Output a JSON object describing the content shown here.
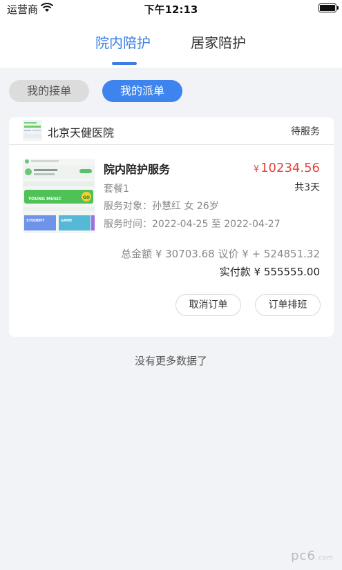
{
  "status_bar": {
    "carrier": "运营商",
    "time": "下午12:13"
  },
  "top_tabs": [
    {
      "label": "院内陪护",
      "active": true
    },
    {
      "label": "居家陪护",
      "active": false
    }
  ],
  "sub_tabs": [
    {
      "label": "我的接单",
      "active": false
    },
    {
      "label": "我的派单",
      "active": true
    }
  ],
  "order": {
    "hospital": "北京天健医院",
    "status": "待服务",
    "service_name": "院内陪护服务",
    "price_symbol": "¥",
    "price": "10234.56",
    "package": "套餐1",
    "days": "共3天",
    "service_object": "服务对象：孙慧红 女 26岁",
    "service_time": "服务时间：2022-04-25 至 2022-04-27",
    "totals": "总金额 ¥ 30703.68  议价 ¥ + 524851.32",
    "paid": "实付款 ¥ 555555.00",
    "cancel_button": "取消订单",
    "schedule_button": "订单排班",
    "thumb_texts": [
      "STUDENT",
      "GAME",
      "YOUNG MUSIC",
      "GO"
    ]
  },
  "footer_text": "没有更多数据了",
  "watermark": "pc6",
  "colors": {
    "accent": "#3b7ee6",
    "price": "#e0463e",
    "background": "#f2f3f7"
  }
}
